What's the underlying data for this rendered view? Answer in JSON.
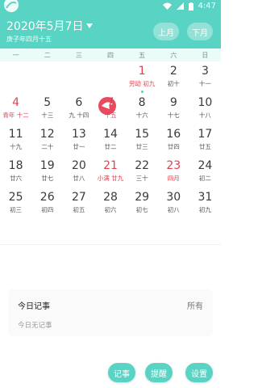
{
  "status": {
    "time": "4:47"
  },
  "header": {
    "date_title": "2020年5月7日",
    "lunar_subtitle": "庚子年四月十五",
    "prev_label": "上月",
    "next_label": "下月"
  },
  "weekdays": [
    "一",
    "二",
    "三",
    "四",
    "五",
    "六",
    "日"
  ],
  "days": [
    {
      "d": "",
      "l": ""
    },
    {
      "d": "",
      "l": ""
    },
    {
      "d": "",
      "l": ""
    },
    {
      "d": "",
      "l": ""
    },
    {
      "d": "1",
      "l": "劳动 初九",
      "red": true,
      "dot": true
    },
    {
      "d": "2",
      "l": "初十"
    },
    {
      "d": "3",
      "l": "十一"
    },
    {
      "d": "4",
      "l": "青年 十二",
      "red": true
    },
    {
      "d": "5",
      "l": "十三"
    },
    {
      "d": "6",
      "l": "九 十四"
    },
    {
      "d": "7",
      "l": "十五",
      "red": true
    },
    {
      "d": "8",
      "l": "十六"
    },
    {
      "d": "9",
      "l": "十七"
    },
    {
      "d": "10",
      "l": "十八"
    },
    {
      "d": "11",
      "l": "十九"
    },
    {
      "d": "12",
      "l": "二十"
    },
    {
      "d": "13",
      "l": "廿一"
    },
    {
      "d": "14",
      "l": "廿二"
    },
    {
      "d": "15",
      "l": "廿三"
    },
    {
      "d": "16",
      "l": "廿四"
    },
    {
      "d": "17",
      "l": "廿五"
    },
    {
      "d": "18",
      "l": "廿六"
    },
    {
      "d": "19",
      "l": "廿七"
    },
    {
      "d": "20",
      "l": "廿八"
    },
    {
      "d": "21",
      "l": "小满 廿九",
      "red": true
    },
    {
      "d": "22",
      "l": "三十"
    },
    {
      "d": "23",
      "l": "四月",
      "red": true
    },
    {
      "d": "24",
      "l": "初二"
    },
    {
      "d": "25",
      "l": "初三"
    },
    {
      "d": "26",
      "l": "初四"
    },
    {
      "d": "27",
      "l": "初五"
    },
    {
      "d": "28",
      "l": "初六"
    },
    {
      "d": "29",
      "l": "初七"
    },
    {
      "d": "30",
      "l": "初八"
    },
    {
      "d": "31",
      "l": "初九"
    }
  ],
  "events": {
    "title": "今日记事",
    "all_label": "所有",
    "empty_text": "今日无记事"
  },
  "actions": {
    "note_label": "记事",
    "remind_label": "提醒",
    "settings_label": "设置"
  },
  "colors": {
    "accent": "#58d3c4",
    "holiday": "#e2404f"
  }
}
